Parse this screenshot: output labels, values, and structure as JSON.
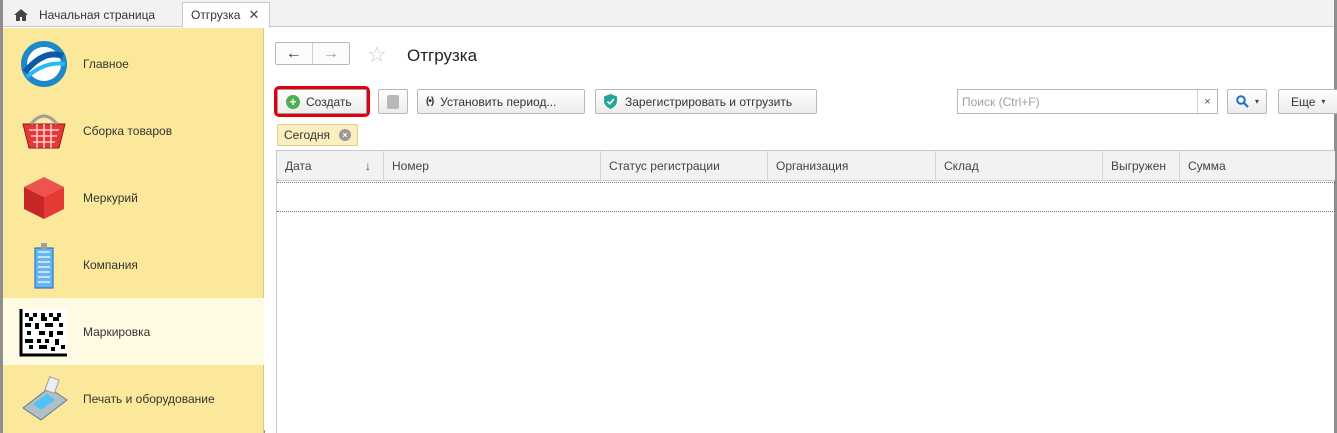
{
  "tabs": {
    "home_label": "Начальная страница",
    "active_label": "Отгрузка",
    "close_glyph": "✕"
  },
  "sidebar": {
    "items": [
      {
        "label": "Главное",
        "icon": "main-logo-icon"
      },
      {
        "label": "Сборка товаров",
        "icon": "basket-icon"
      },
      {
        "label": "Меркурий",
        "icon": "red-cube-icon"
      },
      {
        "label": "Компания",
        "icon": "building-icon"
      },
      {
        "label": "Маркировка",
        "icon": "datamatrix-icon",
        "active": true
      },
      {
        "label": "Печать и оборудование",
        "icon": "payment-terminal-icon"
      }
    ]
  },
  "header": {
    "title": "Отгрузка",
    "back_glyph": "←",
    "forward_glyph": "→",
    "star_glyph": "☆"
  },
  "toolbar": {
    "create_label": "Создать",
    "period_label": "Установить период...",
    "register_label": "Зарегистрировать и отгрузить",
    "more_label": "Еще",
    "period_glyph": "(•)",
    "caret_glyph": "▾"
  },
  "search": {
    "placeholder": "Поиск (Ctrl+F)",
    "value": "",
    "clear_glyph": "×"
  },
  "filter": {
    "chip_label": "Сегодня",
    "chip_close_glyph": "×"
  },
  "table": {
    "sort_glyph": "↓",
    "columns": [
      "Дата",
      "Номер",
      "Статус регистрации",
      "Организация",
      "Склад",
      "Выгружен",
      "Сумма"
    ],
    "rows": []
  },
  "colors": {
    "sidebar_bg": "#fce89b",
    "sidebar_active_bg": "#fffbe3",
    "highlight_red": "#e2000f",
    "create_icon_green": "#4caf50"
  }
}
